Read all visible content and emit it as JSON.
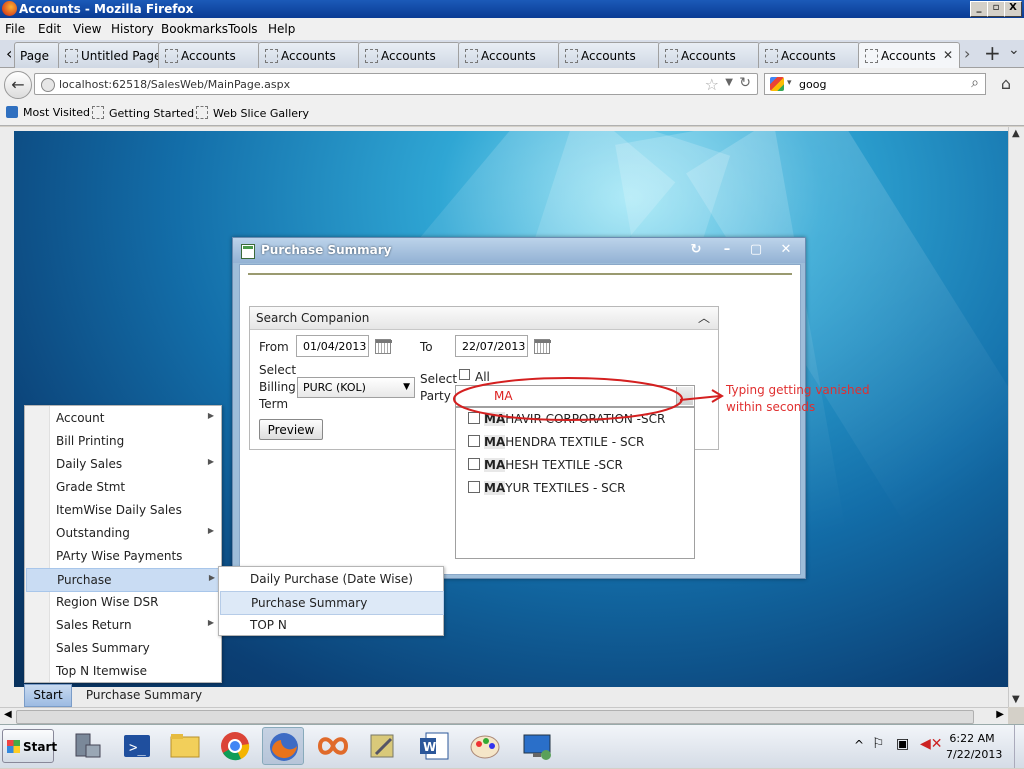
{
  "window": {
    "title": "Accounts - Mozilla Firefox",
    "controls": [
      "_",
      "▫",
      "X"
    ]
  },
  "menubar": [
    "File",
    "Edit",
    "View",
    "History",
    "Bookmarks",
    "Tools",
    "Help"
  ],
  "tabs": {
    "scroll_left": "‹",
    "items": [
      "Page",
      "Untitled Page",
      "Accounts",
      "Accounts",
      "Accounts",
      "Accounts",
      "Accounts",
      "Accounts",
      "Accounts",
      "Accounts"
    ],
    "active_index": 9,
    "scroll_right": "›",
    "new_tab": "+",
    "list": "⌄"
  },
  "navbar": {
    "url": "localhost:62518/SalesWeb/MainPage.aspx",
    "search_value": "goog"
  },
  "bookmarks": [
    "Most Visited",
    "Getting Started",
    "Web Slice Gallery"
  ],
  "dialog": {
    "title": "Purchase Summary",
    "companion": {
      "title": "Search Companion",
      "from_label": "From",
      "from_value": "01/04/2013",
      "to_label": "To",
      "to_value": "22/07/2013",
      "billing_label_1": "Select",
      "billing_label_2": "Billing",
      "billing_label_3": "Term",
      "billing_value": "PURC (KOL)",
      "party_label_1": "Select",
      "party_label_2": "Party",
      "all_label": "All",
      "party_input": "MA",
      "preview": "Preview",
      "parties": [
        {
          "match": "MA",
          "rest": "HAVIR CORPORATION -SCR"
        },
        {
          "match": "MA",
          "rest": "HENDRA TEXTILE - SCR"
        },
        {
          "match": "MA",
          "rest": "HESH TEXTILE -SCR"
        },
        {
          "match": "MA",
          "rest": "YUR TEXTILES - SCR"
        }
      ]
    }
  },
  "annotation": {
    "line1": "Typing getting vanished",
    "line2": "within seconds",
    "color": "#e03030"
  },
  "startmenu": {
    "items": [
      "Account",
      "Bill Printing",
      "Daily Sales",
      "Grade Stmt",
      "ItemWise Daily Sales",
      "Outstanding",
      "PArty Wise Payments",
      "Purchase",
      "Region Wise DSR",
      "Sales Return",
      "Sales Summary",
      "Top N Itemwise"
    ],
    "submenu_flags": [
      true,
      false,
      true,
      false,
      false,
      true,
      false,
      true,
      false,
      true,
      false,
      false
    ],
    "highlighted_index": 7
  },
  "submenu": {
    "items": [
      "Daily Purchase (Date Wise)",
      "Purchase Summary",
      "TOP N"
    ],
    "highlighted_index": 1
  },
  "app_taskbar": {
    "start": "Start",
    "task": "Purchase Summary"
  },
  "taskbar": {
    "start": "Start",
    "pinned_icons": [
      "server-manager-icon",
      "powershell-icon",
      "explorer-folder-icon",
      "chrome-icon",
      "firefox-icon",
      "vs-infinity-icon",
      "tools-icon",
      "word-icon",
      "paint-icon",
      "remote-desktop-icon"
    ],
    "active_icon_index": 4,
    "time": "6:22 AM",
    "date": "7/22/2013"
  }
}
